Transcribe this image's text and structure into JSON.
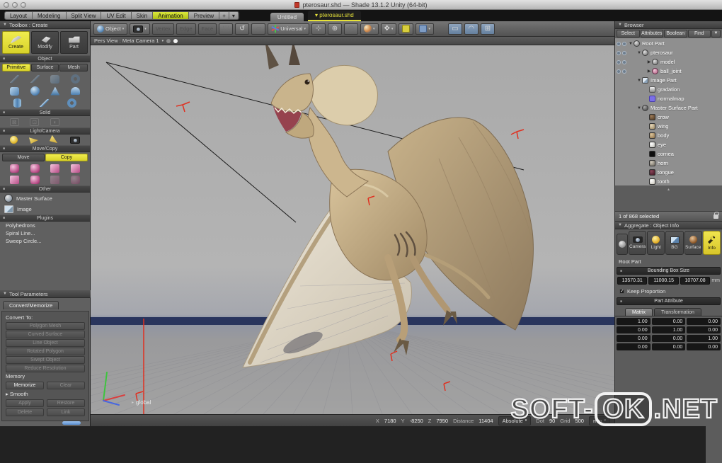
{
  "icons": {
    "disclosure_open": "▼",
    "disclosure_closed": "▶",
    "dropdown": "▾",
    "scroll_up": "▴",
    "funnel": "▼",
    "bullet": "■"
  },
  "window": {
    "title": "pterosaur.shd — Shade 13.1.2 Unity (64-bit)"
  },
  "workspace": {
    "tabs": [
      "Layout",
      "Modeling",
      "Split View",
      "UV Edit",
      "Skin",
      "Animation",
      "Preview"
    ],
    "active_tab": "Animation",
    "add_button": "+",
    "menu_button": "▾",
    "doc_tabs": [
      "Untitled",
      "pterosaur.shd"
    ],
    "active_doc": "pterosaur.shd"
  },
  "toolbar": {
    "object_label": "Object",
    "universal_label": "Universal",
    "disabled": [
      "Vertex",
      "Edge",
      "Face"
    ]
  },
  "toolbox": {
    "header": "Toolbox : Create",
    "modes": [
      "Create",
      "Modify",
      "Part"
    ],
    "active_mode": "Create",
    "object_section": "Object",
    "object_tabs": [
      "Primitive",
      "Surface",
      "Mesh"
    ],
    "active_object_tab": "Primitive",
    "solid_section": "Solid",
    "light_camera_section": "Light/Camera",
    "move_copy_section": "Move/Copy",
    "move_copy_tabs": [
      "Move",
      "Copy"
    ],
    "active_move_copy_tab": "Copy",
    "other_section": "Other",
    "other_items": [
      "Master Surface",
      "Image"
    ],
    "plugins_section": "Plugins",
    "plugin_items": [
      "Polyhedrons",
      "Spiral Line...",
      "Sweep Circle..."
    ]
  },
  "tool_parameters": {
    "header": "Tool Parameters",
    "tab": "Convert/Memorize",
    "convert_label": "Convert To:",
    "convert_buttons": [
      "Polygon Mesh",
      "Curved Surface",
      "Line Object",
      "Rotated Polygon",
      "Swept Object",
      "Reduce Resolution"
    ],
    "memory_label": "Memory",
    "memorize_label": "Memorize",
    "clear_label": "Clear",
    "smooth_label": "Smooth",
    "smooth_buttons": [
      "Apply",
      "Restore",
      "Delete",
      "Link"
    ]
  },
  "viewport": {
    "header": "Pers View : Meta Camera 1",
    "gizmo_label": "global",
    "status": {
      "x_label": "X",
      "x_value": "7180",
      "y_label": "Y",
      "y_value": "-8250",
      "z_label": "Z",
      "z_value": "7950",
      "distance_label": "Distance",
      "distance_value": "11404",
      "mode": "Absolute",
      "dot_label": "Dot",
      "dot_value": "90",
      "grid_label": "Grid",
      "grid_value": "500",
      "unit": "mm"
    }
  },
  "browser": {
    "header": "Browser",
    "tabs": [
      "Select",
      "Attributes",
      "Boolean",
      "Find"
    ],
    "tree": [
      {
        "label": "Root Part"
      },
      {
        "label": "pterosaur"
      },
      {
        "label": "model"
      },
      {
        "label": "ball_joint"
      },
      {
        "label": "Image Part"
      },
      {
        "label": "gradation"
      },
      {
        "label": "normalmap"
      },
      {
        "label": "Master Surface Part"
      },
      {
        "label": "crow"
      },
      {
        "label": "wing"
      },
      {
        "label": "body"
      },
      {
        "label": "eye"
      },
      {
        "label": "cornea"
      },
      {
        "label": "horn"
      },
      {
        "label": "tongue"
      },
      {
        "label": "tooth"
      }
    ],
    "status": "1 of 868 selected"
  },
  "object_info": {
    "header": "Aggregate : Object Info",
    "tabs": [
      "Camera",
      "Light",
      "BG",
      "Surface",
      "Info"
    ],
    "active_tab": "Info",
    "target": "Root Part",
    "bounding_box_title": "Bounding Box Size",
    "bounding_box_values": [
      "13570.31",
      "11000.15",
      "10707.08"
    ],
    "bounding_box_unit": "mm",
    "keep_proportion_label": "Keep Proportion",
    "keep_proportion_checked": "✓",
    "part_attribute_title": "Part Attribute",
    "matrix_tabs": [
      "Matrix",
      "Transformation"
    ],
    "active_matrix_tab": "Matrix",
    "matrix": [
      [
        "1.00",
        "0.00",
        "0.00"
      ],
      [
        "0.00",
        "1.00",
        "0.00"
      ],
      [
        "0.00",
        "0.00",
        "1.00"
      ],
      [
        "0.00",
        "0.00",
        "0.00"
      ]
    ]
  },
  "watermark": {
    "prefix": "SOFT-",
    "boxed": "OK",
    "suffix": ".NET"
  },
  "colors": {
    "highlight_yellow": "#e6e23a",
    "selection_red": "#e03020",
    "horizon_blue": "#1e2a55",
    "primitive_blue": "#4d7fb0",
    "copy_pink": "#b74c86"
  }
}
